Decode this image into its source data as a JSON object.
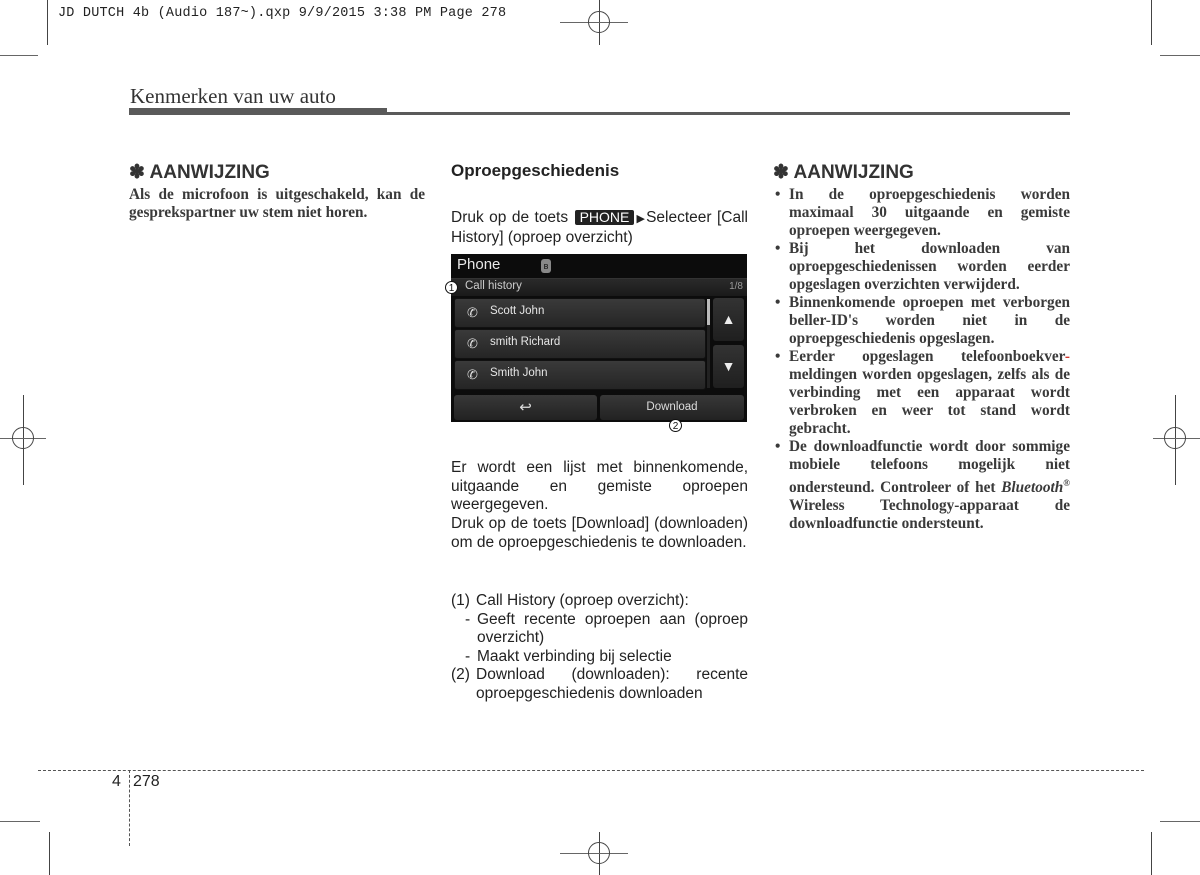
{
  "print_slug": "JD DUTCH 4b (Audio 187~).qxp  9/9/2015  3:38 PM  Page 278",
  "section_title": "Kenmerken van uw auto",
  "left_note": {
    "heading_icon": "asterisk-icon",
    "heading_symbol": "✽",
    "heading": "AANWIJZING",
    "body": "Als de microfoon is uitgeschakeld, kan de gesprekspartner uw stem niet horen."
  },
  "middle": {
    "heading": "Oproepgeschiedenis",
    "instruction_pre": "Druk op de toets",
    "phone_key": "PHONE",
    "arrow_symbol": "▶",
    "instruction_post": "Selecteer [Call History] (oproep overzicht)",
    "screen": {
      "title": "Phone",
      "bluetooth_symbol": "ʙ",
      "subtitle": "Call history",
      "count": "1/8",
      "items": [
        {
          "icon": "outgoing-call-icon",
          "glyph": "✆",
          "name": "Scott John"
        },
        {
          "icon": "outgoing-call-icon",
          "glyph": "✆",
          "name": "smith Richard"
        },
        {
          "icon": "missed-call-icon",
          "glyph": "✆",
          "name": "Smith John"
        }
      ],
      "up_symbol": "▲",
      "down_symbol": "▼",
      "back_symbol": "↩",
      "download_label": "Download",
      "callout_1": "1",
      "callout_2": "2"
    },
    "para1": "Er wordt een lijst met binnenkomende, uitgaande en gemiste oproepen weergegeven.",
    "para2": "Druk op de toets [Download] (downloaden) om de oproepgeschiedenis te downloaden.",
    "list": [
      {
        "num": "(1)",
        "text": "Call History (oproep overzicht):"
      },
      {
        "sub": "-",
        "text": "Geeft recente oproepen aan (oproep overzicht)"
      },
      {
        "sub": "-",
        "text": "Maakt verbinding bij selectie"
      },
      {
        "num": "(2)",
        "text": "Download (downloaden): recente oproepgeschiedenis downloaden"
      }
    ]
  },
  "right_note": {
    "heading_symbol": "✽",
    "heading": "AANWIJZING",
    "bullets": [
      "In de oproepgeschiedenis worden maximaal 30 uitgaande en gemiste oproepen weergegeven.",
      "Bij het downloaden van oproepgeschiedenissen worden eerder opgeslagen overzichten verwijderd.",
      "Binnenkomende oproepen met verborgen beller-ID's worden niet in de oproepgeschiedenis opgeslagen.",
      "Eerder opgeslagen telefoonboekvermeldingen worden opgeslagen, zelfs als de verbinding met een apparaat wordt verbroken en weer tot stand wordt gebracht."
    ],
    "bullet4_part1": "Eerder opgeslagen telefoonboekver",
    "bullet4_hyphen": "-",
    "bullet4_part2": "meldingen worden opgeslagen, zelfs als de verbinding met een apparaat wordt verbroken en weer tot stand wordt gebracht.",
    "bullet5_part1": "De downloadfunctie wordt door sommige mobiele telefoons mogelijk niet ondersteund. Controleer of het ",
    "bullet5_italic": "Bluetooth",
    "bullet5_reg": "®",
    "bullet5_part2": " Wireless Technology-apparaat de downloadfunctie ondersteunt."
  },
  "footer": {
    "chapter": "4",
    "page": "278"
  }
}
